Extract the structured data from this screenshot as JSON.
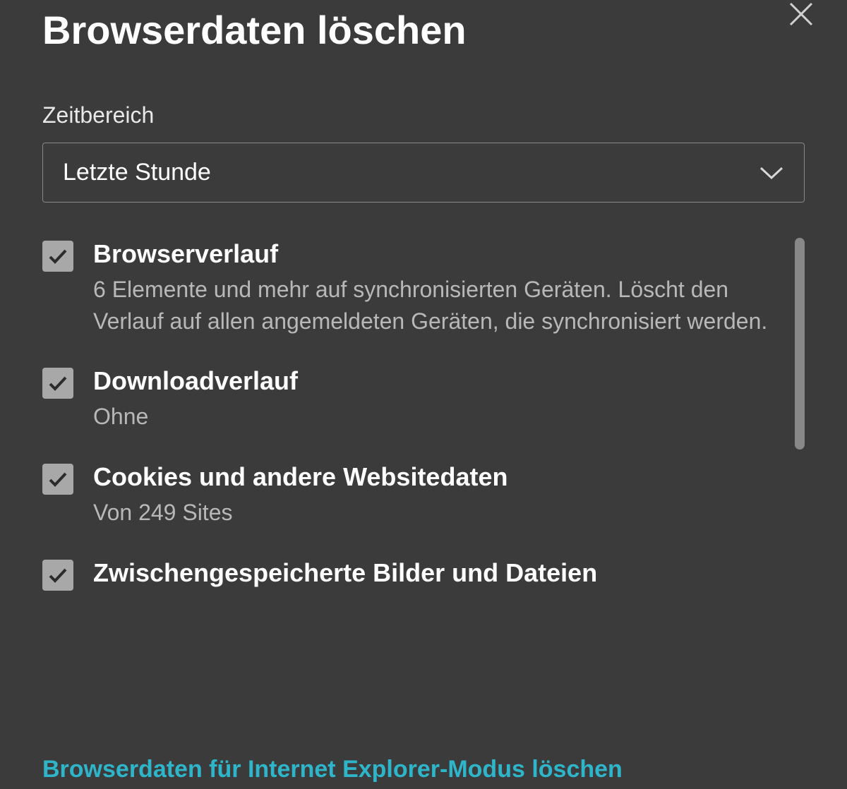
{
  "dialog": {
    "title": "Browserdaten löschen",
    "time_range_label": "Zeitbereich",
    "time_range_value": "Letzte Stunde",
    "options": [
      {
        "checked": true,
        "title": "Browserverlauf",
        "desc": "6 Elemente und mehr auf synchronisierten Geräten. Löscht den Verlauf auf allen angemeldeten Geräten, die synchronisiert werden."
      },
      {
        "checked": true,
        "title": "Downloadverlauf",
        "desc": "Ohne"
      },
      {
        "checked": true,
        "title": "Cookies und andere Websitedaten",
        "desc": "Von 249 Sites"
      },
      {
        "checked": true,
        "title": "Zwischengespeicherte Bilder und Dateien",
        "desc": ""
      }
    ],
    "ie_link": "Browserdaten für Internet Explorer-Modus löschen"
  }
}
